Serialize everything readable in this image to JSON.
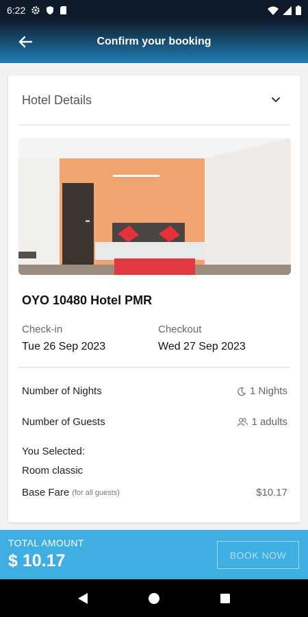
{
  "status": {
    "time": "6:22"
  },
  "header": {
    "title": "Confirm your booking"
  },
  "section": {
    "title": "Hotel Details"
  },
  "hotel": {
    "name": "OYO 10480 Hotel PMR",
    "checkin_label": "Check-in",
    "checkin_value": "Tue 26 Sep 2023",
    "checkout_label": "Checkout",
    "checkout_value": "Wed 27 Sep 2023"
  },
  "details": {
    "nights_label": "Number of Nights",
    "nights_value": "1 Nights",
    "guests_label": "Number of Guests",
    "guests_value": "1 adults",
    "selected_label": "You Selected:",
    "room_type": "Room classic",
    "base_fare_label": "Base Fare",
    "base_fare_note": "(for all guests)",
    "base_fare_value": "$10.17"
  },
  "footer": {
    "total_label": "TOTAL AMOUNT",
    "total_amount": "$ 10.17",
    "book_label": "BOOK NOW"
  }
}
